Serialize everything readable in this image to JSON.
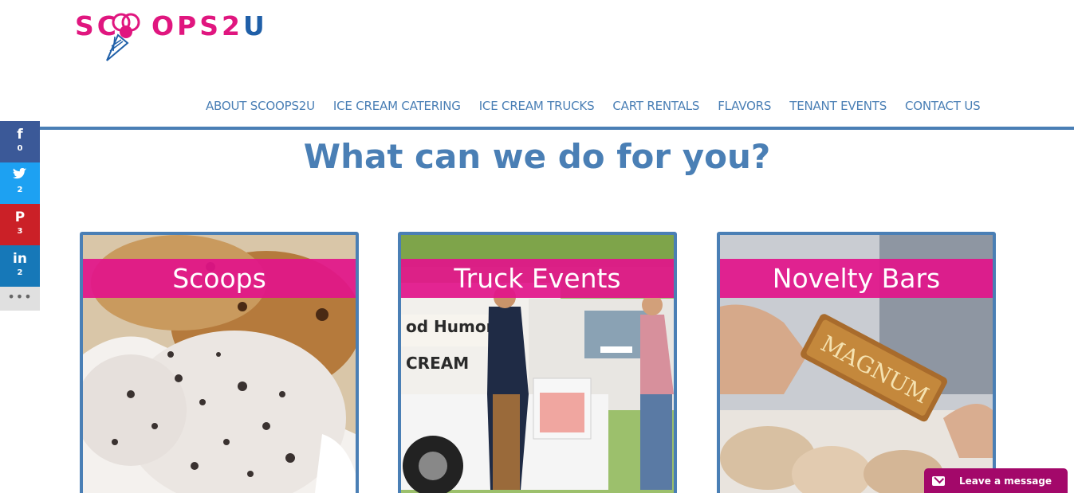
{
  "brand": {
    "logo_parts": [
      "SC",
      "OPS2",
      "U"
    ],
    "colors": {
      "pink": "#e0167f",
      "blue": "#1f5fa8",
      "nav": "#4a7fb5"
    }
  },
  "nav": {
    "items": [
      "ABOUT SCOOPS2U",
      "ICE CREAM CATERING",
      "ICE CREAM TRUCKS",
      "CART RENTALS",
      "FLAVORS",
      "TENANT EVENTS",
      "CONTACT US"
    ]
  },
  "main": {
    "headline": "What can we do for you?",
    "cards": [
      {
        "title": "Scoops"
      },
      {
        "title": "Truck Events"
      },
      {
        "title": "Novelty Bars"
      }
    ]
  },
  "social": {
    "facebook": {
      "icon": "facebook-icon",
      "glyph": "f",
      "count": "0"
    },
    "twitter": {
      "icon": "twitter-icon",
      "glyph": "t",
      "count": "2"
    },
    "pinterest": {
      "icon": "pinterest-icon",
      "glyph": "P",
      "count": "3"
    },
    "linkedin": {
      "icon": "linkedin-icon",
      "glyph": "in",
      "count": "2"
    },
    "more": "•••"
  },
  "chat": {
    "label": "Leave a message",
    "icon": "envelope-icon"
  }
}
